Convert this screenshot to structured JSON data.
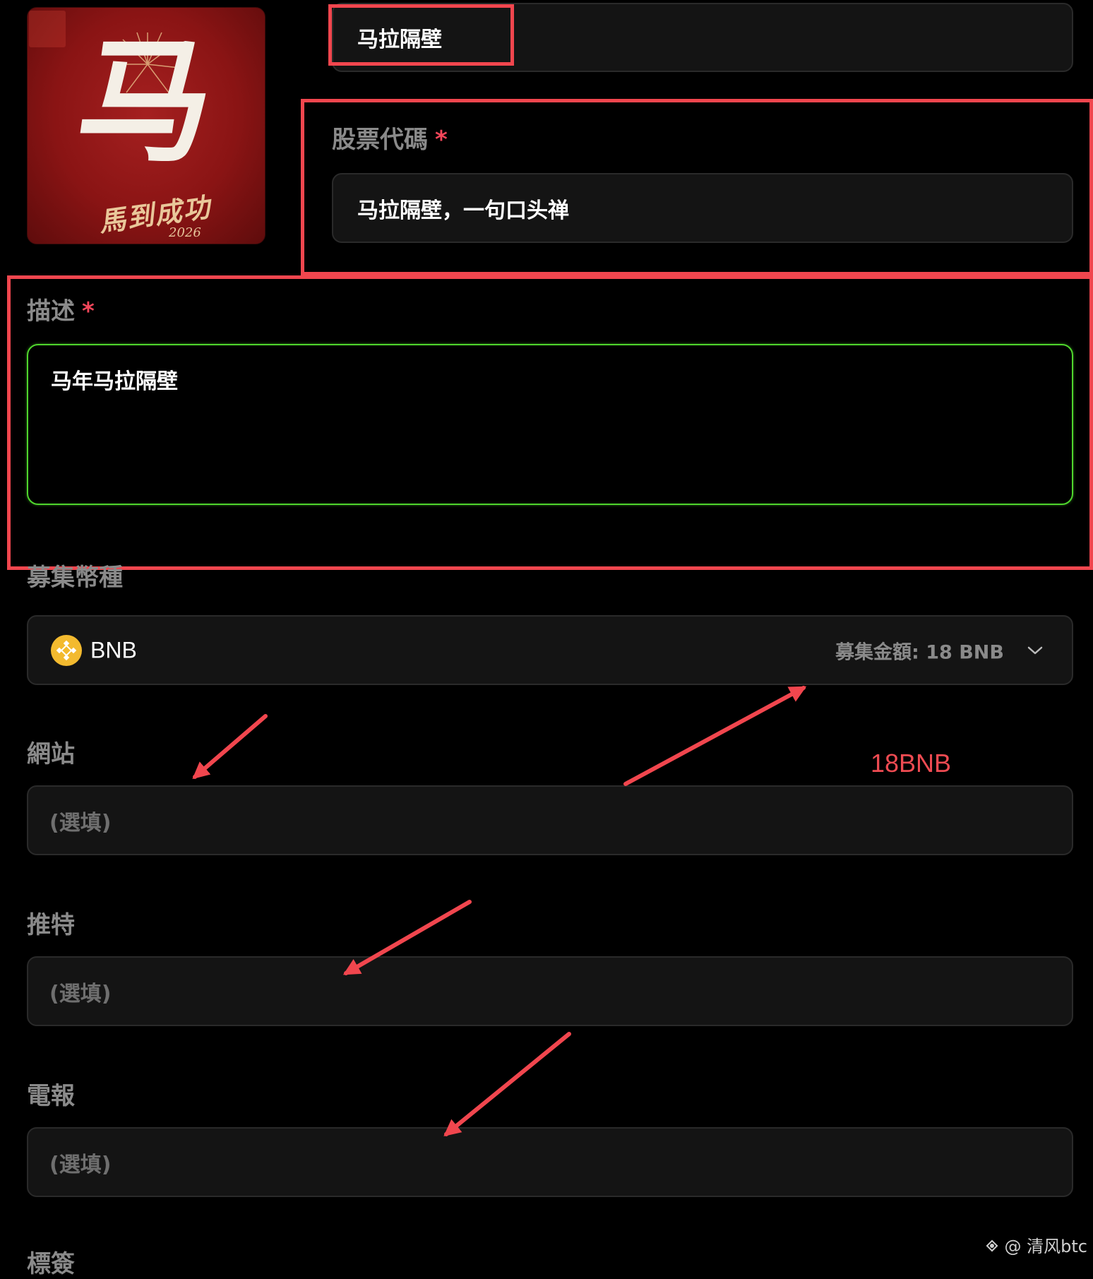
{
  "token": {
    "image_char": "马",
    "image_script": "馬到成功",
    "image_year": "2026"
  },
  "name_field": {
    "value": "马拉隔壁"
  },
  "ticker": {
    "label": "股票代碼",
    "required_mark": "*",
    "value": "马拉隔壁，一句口头禅"
  },
  "description": {
    "label": "描述",
    "required_mark": "*",
    "value": "马年马拉隔壁"
  },
  "raise_currency": {
    "label": "募集幣種",
    "selected": "BNB",
    "amount_text": "募集金額: 18 BNB",
    "icon": "bnb-coin-icon",
    "chevron_icon": "chevron-down-icon"
  },
  "website": {
    "label": "網站",
    "placeholder": "(選填)"
  },
  "twitter": {
    "label": "推特",
    "placeholder": "(選填)"
  },
  "telegram": {
    "label": "電報",
    "placeholder": "(選填)"
  },
  "tags": {
    "label": "標簽"
  },
  "annotation": {
    "note": "18BNB"
  },
  "watermark": {
    "text": "@ 清风btc"
  },
  "colors": {
    "background": "#000000",
    "field_bg": "#141414",
    "annotation_red": "#f1464e",
    "focus_green": "#4fd52d",
    "bnb_yellow": "#f3ba2f"
  }
}
